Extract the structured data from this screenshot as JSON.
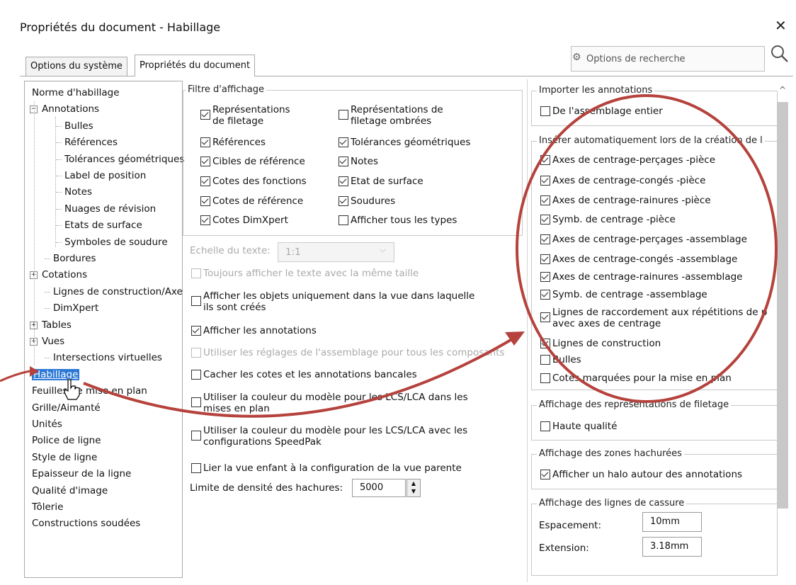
{
  "window": {
    "title": "Propriétés du document - Habillage",
    "close_symbol": "✕"
  },
  "tabs": [
    {
      "label": "Options du système",
      "active": false
    },
    {
      "label": "Propriétés du document",
      "active": true
    }
  ],
  "search": {
    "placeholder": "Options de recherche",
    "gear_icon": "gear-icon",
    "search_icon": "search-icon"
  },
  "tree": {
    "items": [
      {
        "label": "Norme d'habillage"
      },
      {
        "label": "Annotations",
        "expander": "−"
      },
      {
        "label": "Bulles"
      },
      {
        "label": "Références"
      },
      {
        "label": "Tolérances géométriques"
      },
      {
        "label": "Label de position"
      },
      {
        "label": "Notes"
      },
      {
        "label": "Nuages de révision"
      },
      {
        "label": "Etats de surface"
      },
      {
        "label": "Symboles de soudure"
      },
      {
        "label": "Bordures"
      },
      {
        "label": "Cotations",
        "expander": "+"
      },
      {
        "label": "Lignes de construction/Axe"
      },
      {
        "label": "DimXpert"
      },
      {
        "label": "Tables",
        "expander": "+"
      },
      {
        "label": "Vues",
        "expander": "+"
      },
      {
        "label": "Intersections virtuelles"
      },
      {
        "label": "Habillage",
        "selected": true
      },
      {
        "label": "Feuilles de mise en plan"
      },
      {
        "label": "Grille/Aimanté"
      },
      {
        "label": "Unités"
      },
      {
        "label": "Police de ligne"
      },
      {
        "label": "Style de ligne"
      },
      {
        "label": "Epaisseur de la ligne"
      },
      {
        "label": "Qualité d'image"
      },
      {
        "label": "Tôlerie"
      },
      {
        "label": "Constructions soudées"
      }
    ]
  },
  "filter": {
    "title": "Filtre d'affichage",
    "left": [
      {
        "label1": "Représentations",
        "label2": "de filetage",
        "checked": true
      },
      {
        "label1": "Références",
        "checked": true
      },
      {
        "label1": "Cibles de référence",
        "checked": true
      },
      {
        "label1": "Cotes des fonctions",
        "checked": true
      },
      {
        "label1": "Cotes de référence",
        "checked": true
      },
      {
        "label1": "Cotes DimXpert",
        "checked": true
      }
    ],
    "right": [
      {
        "label1": "Représentations de",
        "label2": "filetage ombrées",
        "checked": false
      },
      {
        "label1": "Tolérances géométriques",
        "checked": true
      },
      {
        "label1": "Notes",
        "checked": true
      },
      {
        "label1": "Etat de surface",
        "checked": true
      },
      {
        "label1": "Soudures",
        "checked": true
      },
      {
        "label1": "Afficher tous les types",
        "checked": false
      }
    ]
  },
  "text_scale": {
    "label": "Echelle du texte:",
    "value": "1:1"
  },
  "middle_options": [
    {
      "label1": "Toujours afficher le texte avec la même taille",
      "checked": false,
      "disabled": true
    },
    {
      "label1": "Afficher les objets uniquement dans la vue dans laquelle",
      "label2": "ils sont créés",
      "checked": false
    },
    {
      "label1": "Afficher les annotations",
      "checked": true
    },
    {
      "label1": "Utiliser les réglages de l'assemblage pour tous les composants",
      "checked": false,
      "disabled": true
    },
    {
      "label1": "Cacher les cotes et les annotations bancales",
      "checked": false
    },
    {
      "label1": "Utiliser la couleur du modèle pour les LCS/LCA dans les",
      "label2": "mises en plan",
      "checked": false
    },
    {
      "label1": "Utiliser la couleur du modèle pour les LCS/LCA avec les",
      "label2": "configurations SpeedPak",
      "checked": false
    },
    {
      "label1": "Lier la vue enfant à la configuration de la vue parente",
      "checked": false
    }
  ],
  "hatch_limit": {
    "label": "Limite de densité des hachures:",
    "value": "5000"
  },
  "import": {
    "title": "Importer les annotations",
    "items": [
      {
        "label1": "De l'assemblage entier",
        "checked": false
      }
    ]
  },
  "auto_insert": {
    "title": "Insérer automatiquement lors de la création de l",
    "items": [
      {
        "label1": "Axes de centrage-perçages -pièce",
        "checked": true
      },
      {
        "label1": "Axes de centrage-congés -pièce",
        "checked": true
      },
      {
        "label1": "Axes de centrage-rainures  -pièce",
        "checked": true
      },
      {
        "label1": "Symb. de centrage -pièce",
        "checked": true
      },
      {
        "label1": "Axes de centrage-perçages -assemblage",
        "checked": true
      },
      {
        "label1": "Axes de centrage-congés -assemblage",
        "checked": true
      },
      {
        "label1": "Axes de centrage-rainures  -assemblage",
        "checked": true
      },
      {
        "label1": "Symb. de centrage -assemblage",
        "checked": true
      },
      {
        "label1": "Lignes de raccordement aux répétitions de p",
        "label2": "avec axes de centrage",
        "checked": true
      },
      {
        "label1": "Lignes de construction",
        "checked": true
      },
      {
        "label1": "Bulles",
        "checked": false
      },
      {
        "label1": "Cotes marquées pour la mise en plan",
        "checked": false
      }
    ]
  },
  "thread_display": {
    "title": "Affichage des représentations de filetage",
    "items": [
      {
        "label1": "Haute qualité",
        "checked": false
      }
    ]
  },
  "hatch_zones": {
    "title": "Affichage des zones hachurées",
    "items": [
      {
        "label1": "Afficher un halo autour des annotations",
        "checked": true
      }
    ]
  },
  "break_lines": {
    "title": "Affichage des lignes de cassure",
    "spacing_label": "Espacement:",
    "spacing_value": "10mm",
    "extension_label": "Extension:",
    "extension_value": "3.18mm"
  },
  "colors": {
    "annotation": "#b5423c",
    "selection": "#2b78d6"
  }
}
